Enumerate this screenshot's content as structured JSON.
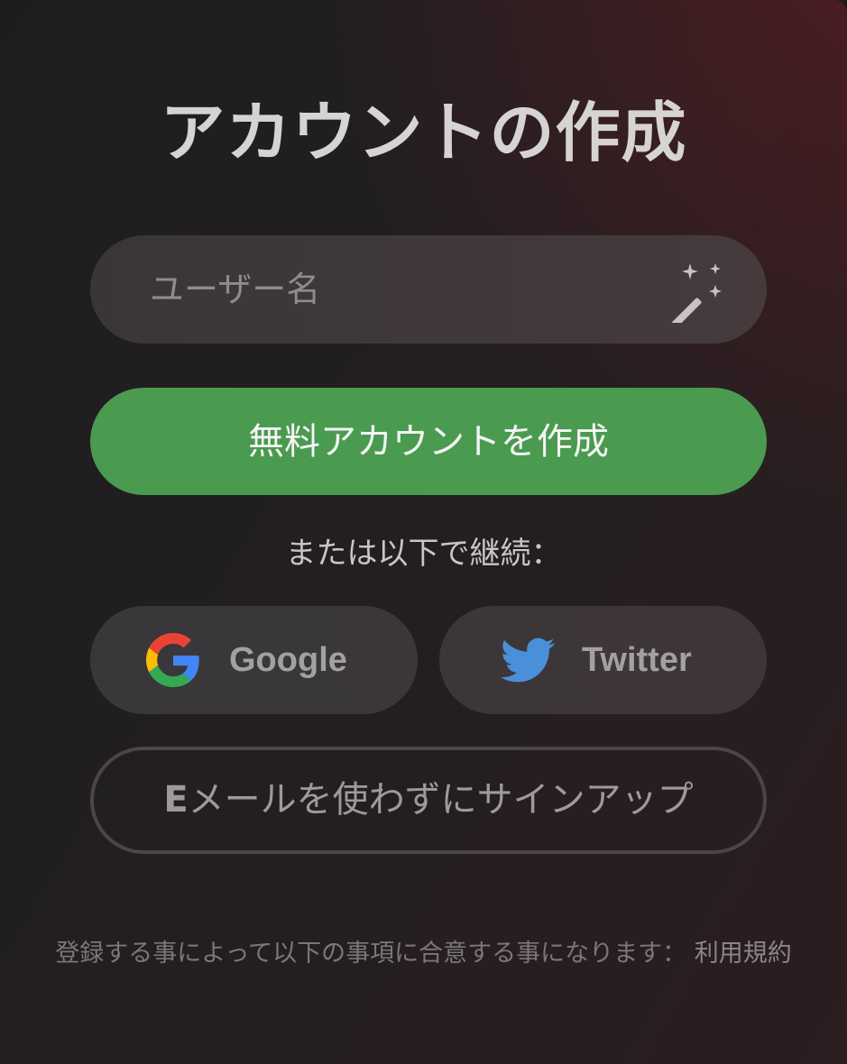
{
  "title": "アカウントの作成",
  "username": {
    "placeholder": "ユーザー名",
    "value": "",
    "icon": "magic-wand-icon"
  },
  "primary_button": {
    "label": "無料アカウントを作成",
    "color": "#4a9a50"
  },
  "or_text": "または以下で継続：",
  "social": {
    "google": {
      "label": "Google",
      "icon": "google-icon"
    },
    "twitter": {
      "label": "Twitter",
      "icon": "twitter-bird-icon",
      "color": "#4a90d9"
    }
  },
  "email_signup": {
    "bold_prefix": "E",
    "label_rest": "メールを使わずにサインアップ"
  },
  "terms": {
    "text": "登録する事によって以下の事項に合意する事になります：",
    "link_label": "利用規約"
  }
}
